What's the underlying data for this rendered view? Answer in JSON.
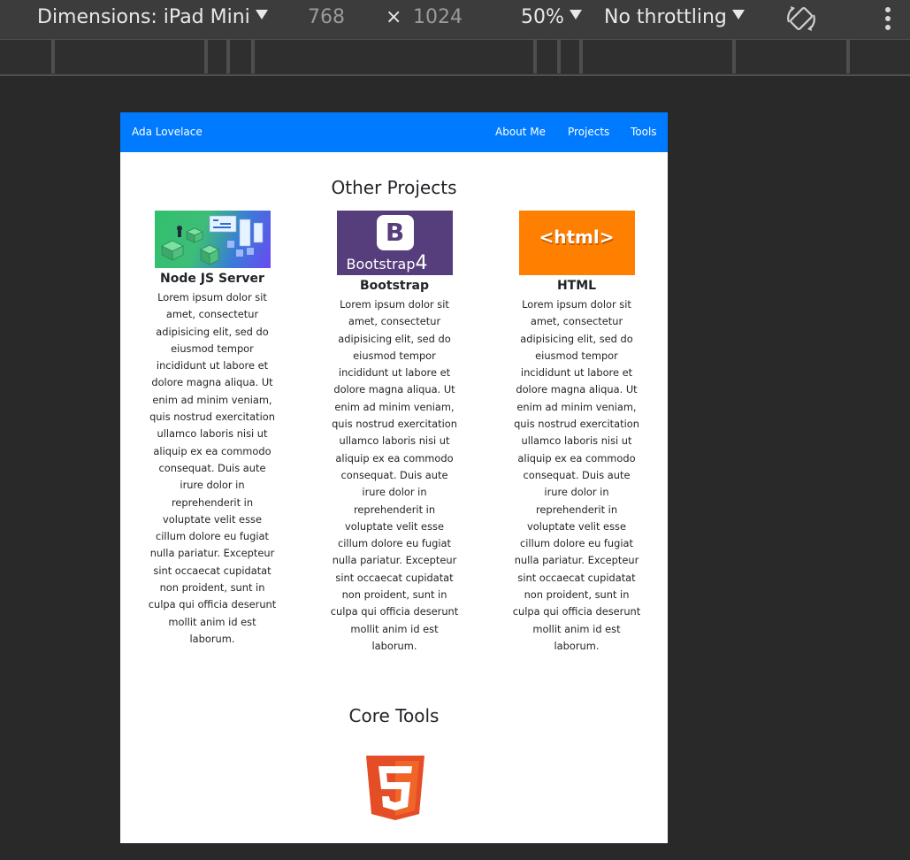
{
  "devtools": {
    "dimensions_label": "Dimensions: iPad Mini",
    "width_value": "768",
    "height_value": "1024",
    "times_symbol": "×",
    "zoom_label": "50%",
    "throttling_label": "No throttling",
    "rotate_icon": "rotate-icon",
    "more_icon": "kebab-menu-icon"
  },
  "page": {
    "brand": "Ada Lovelace",
    "nav": [
      "About Me",
      "Projects",
      "Tools"
    ],
    "projects_title": "Other Projects",
    "projects": [
      {
        "title": "Node JS Server",
        "image": "node-js-server-image",
        "text": "Lorem ipsum dolor sit amet, consectetur adipisicing elit, sed do eiusmod tempor incididunt ut labore et dolore magna aliqua. Ut enim ad minim veniam, quis nostrud exercitation ullamco laboris nisi ut aliquip ex ea commodo consequat. Duis aute irure dolor in reprehenderit in voluptate velit esse cillum dolore eu fugiat nulla pariatur. Excepteur sint occaecat cupidatat non proident, sunt in culpa qui officia deserunt mollit anim id est laborum."
      },
      {
        "title": "Bootstrap",
        "image": "bootstrap-4-logo",
        "image_text": "Bootstrap",
        "image_version": "4",
        "image_letter": "B",
        "text": "Lorem ipsum dolor sit amet, consectetur adipisicing elit, sed do eiusmod tempor incididunt ut labore et dolore magna aliqua. Ut enim ad minim veniam, quis nostrud exercitation ullamco laboris nisi ut aliquip ex ea commodo consequat. Duis aute irure dolor in reprehenderit in voluptate velit esse cillum dolore eu fugiat nulla pariatur. Excepteur sint occaecat cupidatat non proident, sunt in culpa qui officia deserunt mollit anim id est laborum."
      },
      {
        "title": "HTML",
        "image": "html-tag-image",
        "image_text": "<html>",
        "text": "Lorem ipsum dolor sit amet, consectetur adipisicing elit, sed do eiusmod tempor incididunt ut labore et dolore magna aliqua. Ut enim ad minim veniam, quis nostrud exercitation ullamco laboris nisi ut aliquip ex ea commodo consequat. Duis aute irure dolor in reprehenderit in voluptate velit esse cillum dolore eu fugiat nulla pariatur. Excepteur sint occaecat cupidatat non proident, sunt in culpa qui officia deserunt mollit anim id est laborum."
      }
    ],
    "tools_title": "Core Tools",
    "tools": [
      {
        "icon": "html5-logo-icon",
        "number": "5"
      }
    ]
  },
  "colors": {
    "navbar": "#007bff",
    "devtools_bar": "#3c3c3c",
    "background": "#292929",
    "html5_orange": "#e44d26",
    "bootstrap_purple": "#563d7c",
    "html_orange": "#ff7f00"
  }
}
